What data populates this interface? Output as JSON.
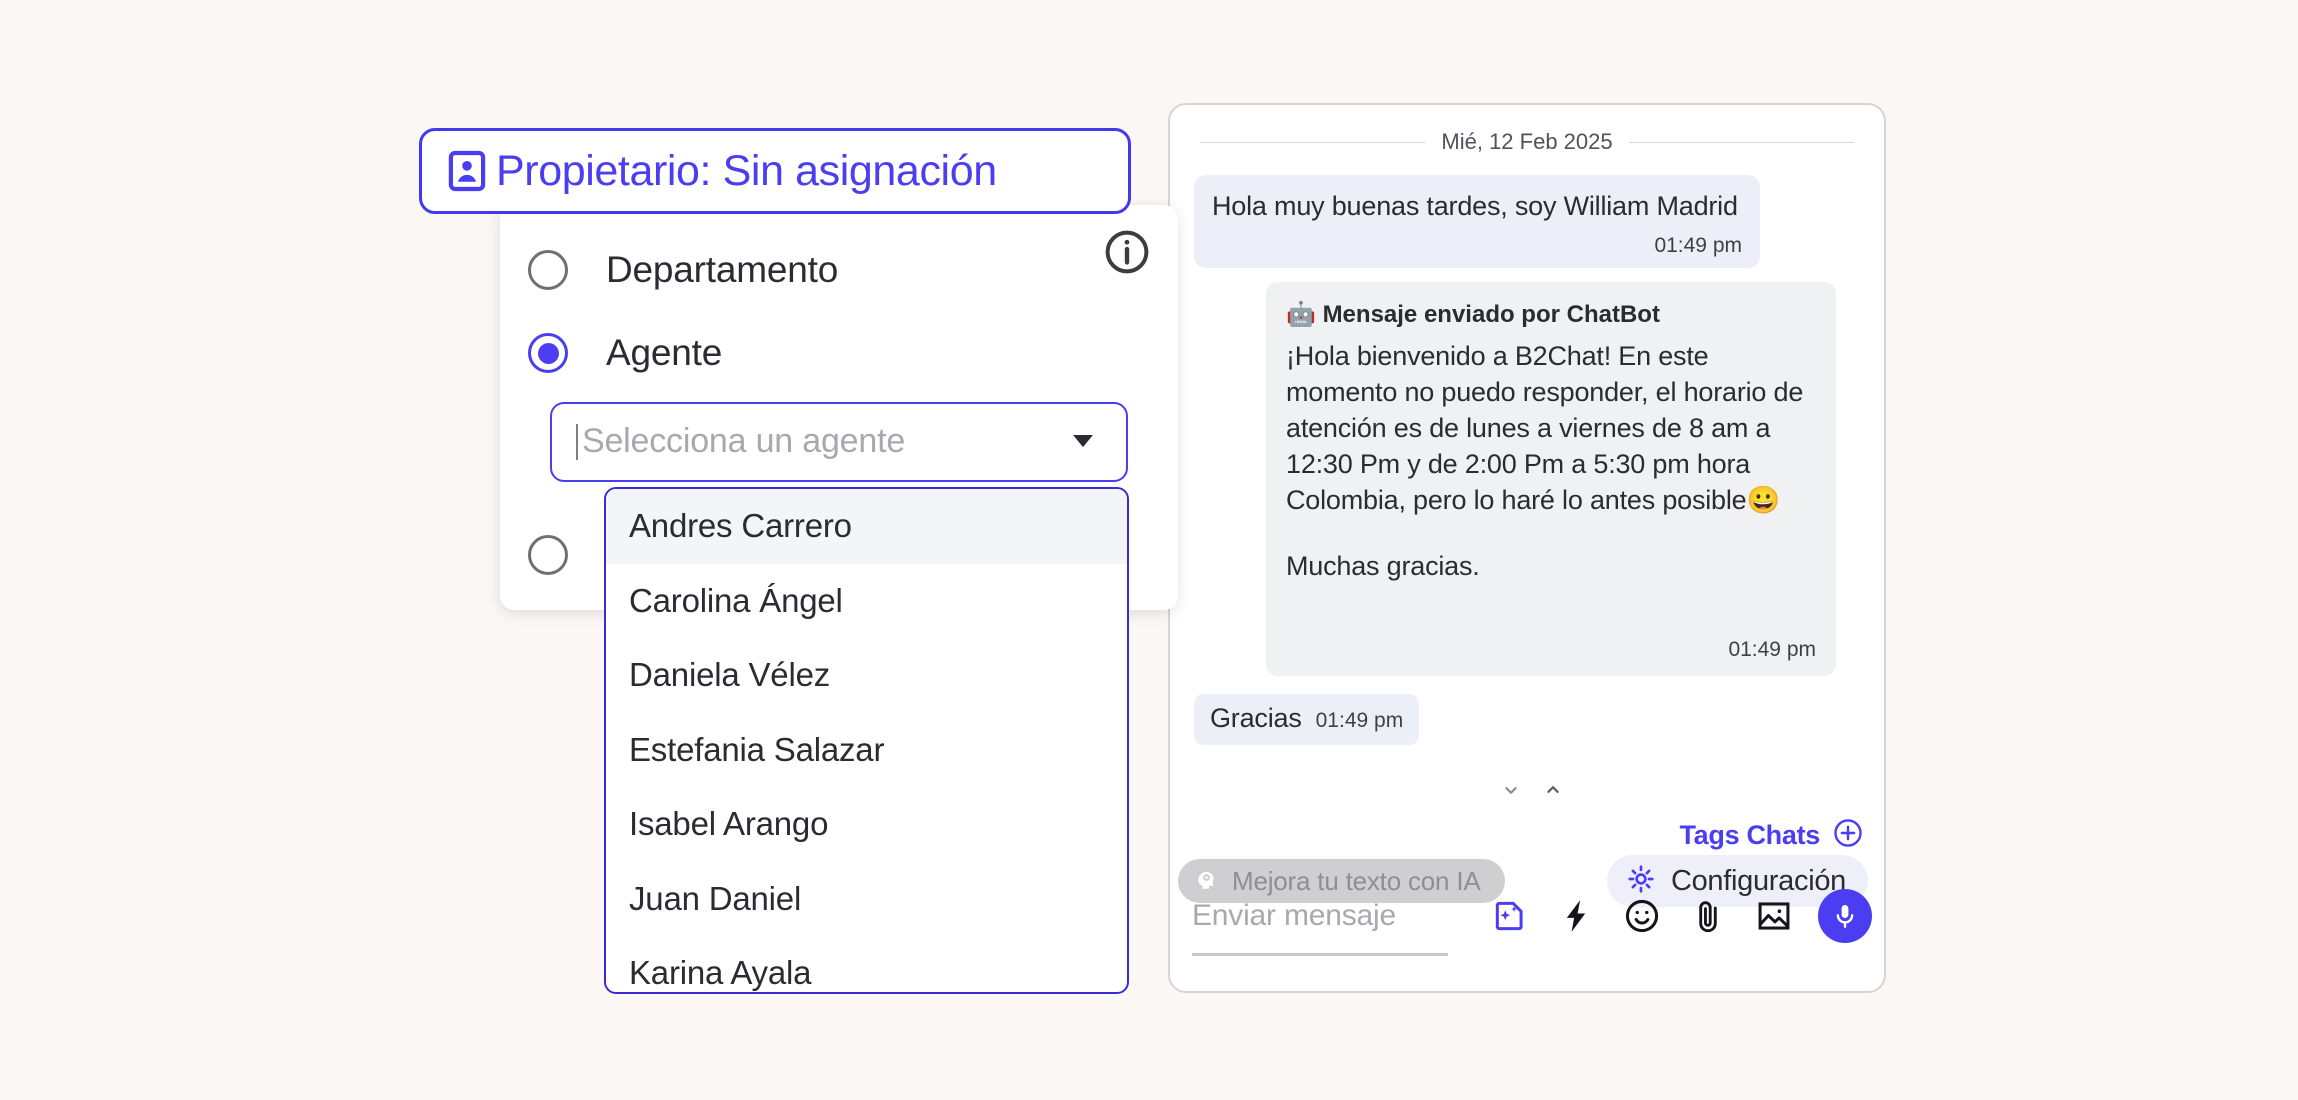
{
  "owner": {
    "pill_label": "Propietario: Sin asignación",
    "pill_icon": "id-card-icon",
    "accent_color": "#4B3EF2",
    "info_icon": "info-circle-icon",
    "options": [
      {
        "label": "Departamento",
        "selected": false
      },
      {
        "label": "Agente",
        "selected": true
      },
      {
        "label": "",
        "selected": false
      }
    ],
    "agent_select": {
      "placeholder": "Selecciona un agente",
      "value": "",
      "caret_icon": "chevron-down-icon"
    },
    "agent_list": [
      {
        "name": "Andres Carrero",
        "highlighted": true
      },
      {
        "name": "Carolina Ángel",
        "highlighted": false
      },
      {
        "name": "Daniela Vélez",
        "highlighted": false
      },
      {
        "name": "Estefania Salazar",
        "highlighted": false
      },
      {
        "name": "Isabel Arango",
        "highlighted": false
      },
      {
        "name": "Juan Daniel",
        "highlighted": false
      },
      {
        "name": "Karina Ayala",
        "highlighted": false
      }
    ]
  },
  "chat": {
    "date_separator": "Mié, 12 Feb 2025",
    "messages": [
      {
        "kind": "incoming",
        "text": "Hola muy buenas tardes, soy William Madrid",
        "time": "01:49 pm"
      },
      {
        "kind": "bot",
        "header_emoji": "🤖",
        "header": "Mensaje enviado por ChatBot",
        "text": "¡Hola bienvenido a B2Chat! En este momento no puedo responder, el horario de atención es de lunes a viernes de 8 am a 12:30 Pm y de 2:00 Pm a 5:30 pm hora Colombia, pero lo haré lo antes posible😀",
        "text2": "Muchas gracias.",
        "time": "01:49 pm"
      },
      {
        "kind": "incoming-short",
        "text": "Gracias",
        "time": "01:49 pm"
      }
    ],
    "footer": {
      "nav_down_icon": "chevron-down-icon",
      "nav_up_icon": "chevron-up-icon",
      "tags_label": "Tags Chats",
      "tags_add_icon": "plus-circle-icon",
      "ai_badge_label": "Mejora tu texto con IA",
      "ai_badge_icon": "ai-head-gear-icon",
      "config_label": "Configuración",
      "config_icon": "gear-icon",
      "message_placeholder": "Enviar mensaje",
      "composer_icons": [
        "ai-template-icon",
        "quick-reply-lightning-icon",
        "emoji-icon",
        "attachment-clip-icon",
        "image-icon"
      ],
      "mic_icon": "microphone-icon"
    }
  }
}
